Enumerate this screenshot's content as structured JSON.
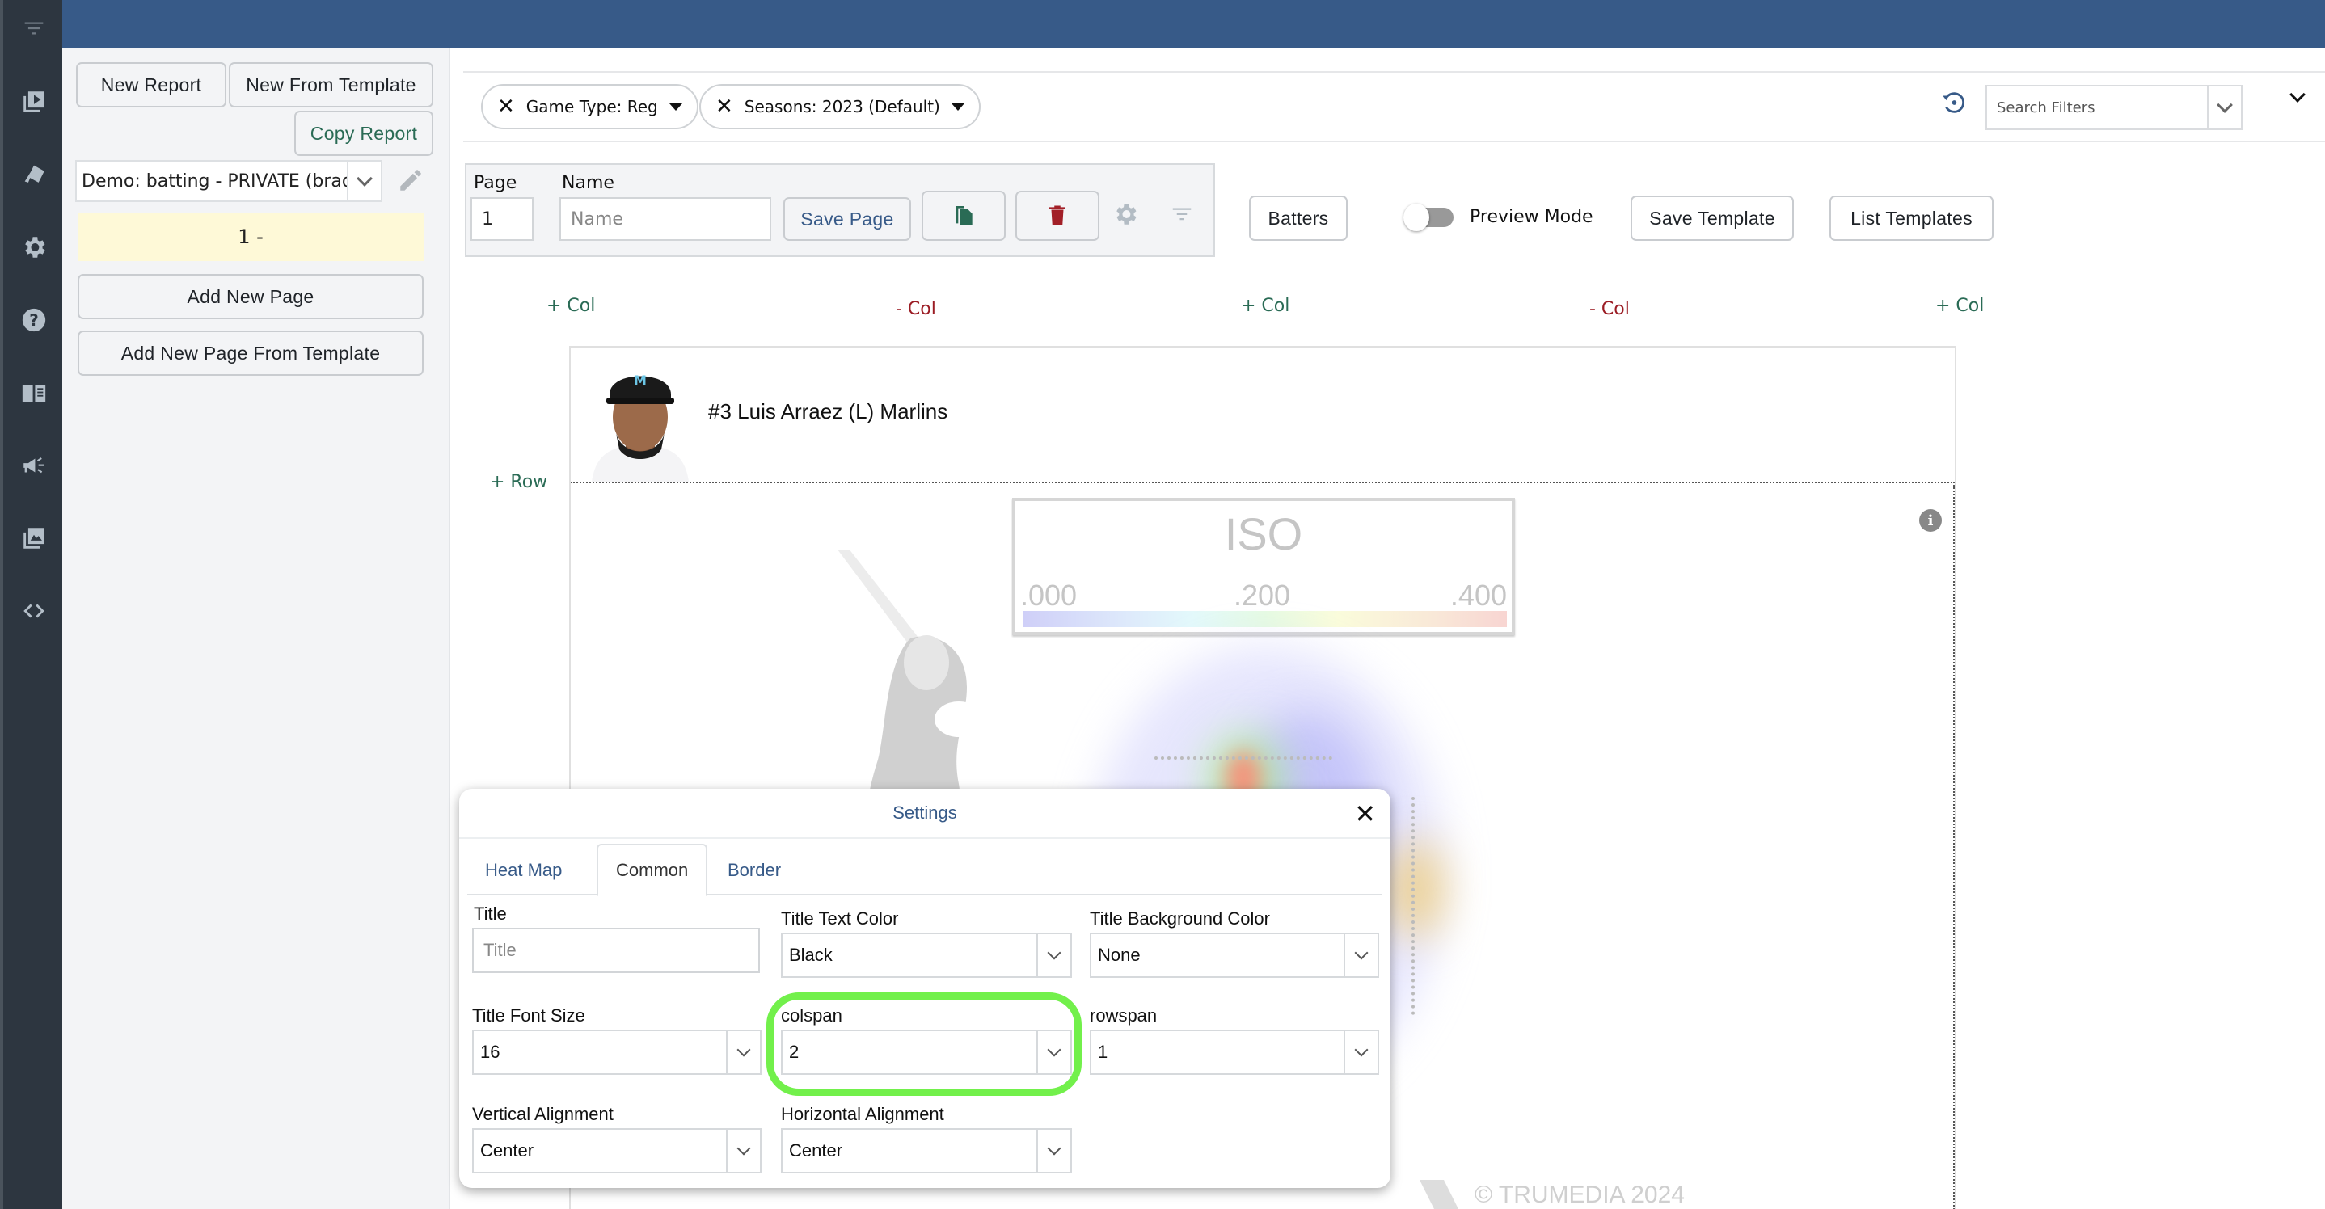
{
  "rail": {
    "icons": [
      "filter-icon",
      "video-library-icon",
      "cards-icon",
      "gear-icon",
      "help-icon",
      "book-icon",
      "megaphone-icon",
      "image-gallery-icon",
      "code-icon"
    ]
  },
  "left_panel": {
    "new_report": "New Report",
    "new_from_template": "New From Template",
    "copy_report": "Copy Report",
    "report_selected": "Demo: batting - PRIVATE (brad...",
    "page_item": "1 -",
    "add_new_page": "Add New Page",
    "add_new_page_from_template": "Add New Page From Template"
  },
  "filters": {
    "chips": [
      {
        "label": "Game Type: Reg"
      },
      {
        "label": "Seasons: 2023 (Default)"
      }
    ],
    "search_placeholder": "Search Filters"
  },
  "page_editor": {
    "page_label": "Page",
    "page_value": "1",
    "name_label": "Name",
    "name_placeholder": "Name",
    "save_page": "Save Page",
    "batters": "Batters",
    "preview_mode": "Preview Mode",
    "preview_mode_on": false,
    "save_template": "Save Template",
    "list_templates": "List Templates"
  },
  "grid_controls": {
    "add_col": "+ Col",
    "remove_col": "- Col",
    "add_row": "+ Row"
  },
  "report": {
    "player_name": "#3 Luis Arraez (L) Marlins",
    "heatmap_legend": {
      "title": "ISO",
      "ticks": [
        ".000",
        ".200",
        ".400"
      ]
    },
    "watermark": "© TRUMEDIA 2024"
  },
  "settings_modal": {
    "title": "Settings",
    "tabs": [
      "Heat Map",
      "Common",
      "Border"
    ],
    "active_tab": "Common",
    "fields": {
      "title_label": "Title",
      "title_placeholder": "Title",
      "title_text_color_label": "Title Text Color",
      "title_text_color": "Black",
      "title_bg_color_label": "Title Background Color",
      "title_bg_color": "None",
      "title_font_size_label": "Title Font Size",
      "title_font_size": "16",
      "colspan_label": "colspan",
      "colspan": "2",
      "rowspan_label": "rowspan",
      "rowspan": "1",
      "vertical_alignment_label": "Vertical Alignment",
      "vertical_alignment": "Center",
      "horizontal_alignment_label": "Horizontal Alignment",
      "horizontal_alignment": "Center"
    }
  },
  "colors": {
    "brand_blue": "#375a88",
    "accent_green": "#2a6b55",
    "danger_red": "#9b1c24",
    "highlight": "#72f04b",
    "page_pill_bg": "#fef9d7"
  }
}
